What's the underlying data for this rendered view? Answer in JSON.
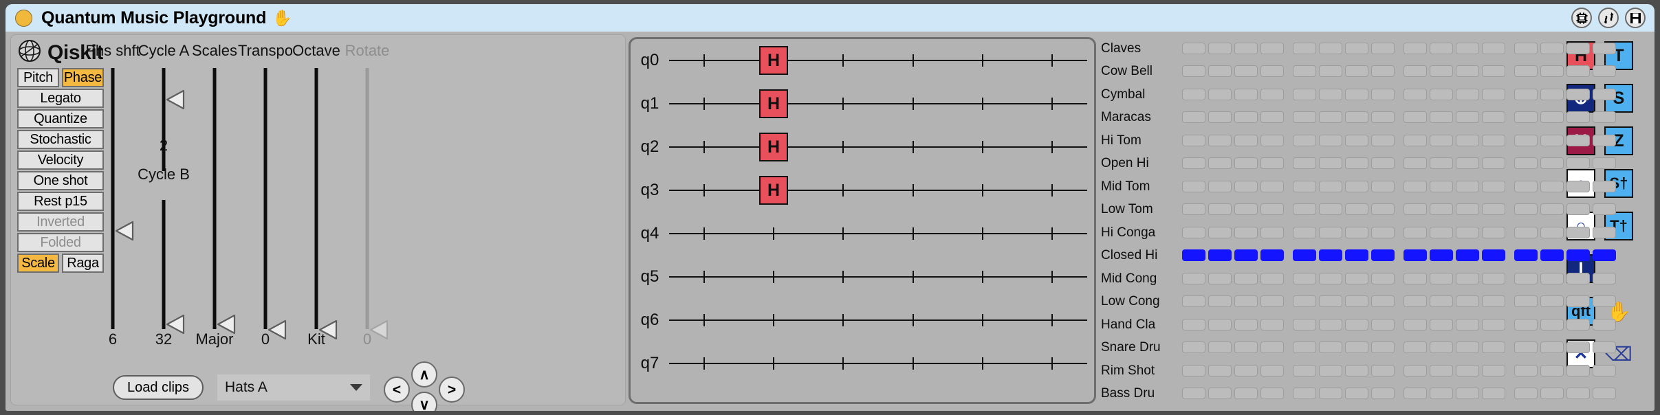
{
  "window": {
    "title": "Quantum Music Playground",
    "title_dot_color": "#f0b93c",
    "titlebar_color": "#cfe7f7",
    "hand_glyph": "✋",
    "icons": [
      {
        "name": "device-chip-icon",
        "label": "device"
      },
      {
        "name": "refresh-sync-icon",
        "label": "refresh"
      },
      {
        "name": "save-disk-icon",
        "label": "save"
      }
    ]
  },
  "left_panel": {
    "brand": "Qiskit",
    "brand_icon": "qiskit-logo-icon",
    "toggle_pair_top": [
      {
        "label": "Pitch",
        "active": false,
        "enabled": true
      },
      {
        "label": "Phase",
        "active": true,
        "enabled": true
      }
    ],
    "toggles": [
      {
        "label": "Legato",
        "active": false,
        "enabled": true
      },
      {
        "label": "Quantize",
        "active": false,
        "enabled": true
      },
      {
        "label": "Stochastic",
        "active": false,
        "enabled": true
      },
      {
        "label": "Velocity",
        "active": false,
        "enabled": true
      },
      {
        "label": "One shot",
        "active": false,
        "enabled": true
      },
      {
        "label": "Rest p15",
        "active": false,
        "enabled": true
      },
      {
        "label": "Inverted",
        "active": false,
        "enabled": false
      },
      {
        "label": "Folded",
        "active": false,
        "enabled": false
      }
    ],
    "toggle_pair_bottom": [
      {
        "label": "Scale",
        "active": true,
        "enabled": true
      },
      {
        "label": "Raga",
        "active": false,
        "enabled": true
      }
    ],
    "sliders": [
      {
        "name": "phase-shift",
        "label": "Phs shft",
        "value": "6",
        "enabled": true,
        "fill_ratio": 0.62,
        "mid_label": ""
      },
      {
        "name": "cycle-a",
        "label": "Cycle A",
        "value": "",
        "enabled": true,
        "fill_ratio": 0.22,
        "mid_label": "2"
      },
      {
        "name": "cycle-b",
        "label": "Cycle B",
        "value": "32",
        "enabled": true,
        "fill_ratio": 0.97,
        "mid_label": ""
      },
      {
        "name": "scales",
        "label": "Scales",
        "value": "Major",
        "enabled": true,
        "fill_ratio": 0.98,
        "mid_label": ""
      },
      {
        "name": "transpose",
        "label": "Transpo",
        "value": "0",
        "enabled": true,
        "fill_ratio": 1.0,
        "mid_label": ""
      },
      {
        "name": "octave",
        "label": "Octave",
        "value": "Kit",
        "enabled": true,
        "fill_ratio": 1.0,
        "mid_label": ""
      },
      {
        "name": "rotate",
        "label": "Rotate",
        "value": "0",
        "enabled": false,
        "fill_ratio": 1.0,
        "mid_label": ""
      }
    ],
    "load_clips_label": "Load clips",
    "clip_menu_value": "Hats A",
    "nav_buttons": [
      {
        "name": "nav-left-button",
        "glyph": "<"
      },
      {
        "name": "nav-up-button",
        "glyph": "∧"
      },
      {
        "name": "nav-down-button",
        "glyph": "∨"
      },
      {
        "name": "nav-right-button",
        "glyph": ">"
      }
    ]
  },
  "circuit": {
    "qubits": [
      "q0",
      "q1",
      "q2",
      "q3",
      "q4",
      "q5",
      "q6",
      "q7"
    ],
    "columns": 6,
    "gates": [
      {
        "qubit": 0,
        "column": 1,
        "label": "H",
        "type": "H"
      },
      {
        "qubit": 1,
        "column": 1,
        "label": "H",
        "type": "H"
      },
      {
        "qubit": 2,
        "column": 1,
        "label": "H",
        "type": "H"
      },
      {
        "qubit": 3,
        "column": 1,
        "label": "H",
        "type": "H"
      }
    ],
    "h_gate_color": "#e8505b"
  },
  "palette": {
    "left_column": [
      {
        "name": "gate-h",
        "label": "H",
        "style": "red"
      },
      {
        "name": "gate-cnot",
        "label": "⊕",
        "style": "navy"
      },
      {
        "name": "gate-y",
        "label": "Y",
        "style": "maroon"
      },
      {
        "name": "gate-control-filled",
        "label": "●",
        "style": "white"
      },
      {
        "name": "gate-control-open",
        "label": "○",
        "style": "white"
      },
      {
        "name": "gate-identity",
        "label": "I",
        "style": "navy"
      },
      {
        "name": "gate-qft",
        "label": "qft",
        "style": "qft"
      },
      {
        "name": "gate-x",
        "label": "✕",
        "style": "white"
      }
    ],
    "right_column": [
      {
        "name": "gate-t",
        "label": "T",
        "style": "lblue"
      },
      {
        "name": "gate-s",
        "label": "S",
        "style": "lblue"
      },
      {
        "name": "gate-z",
        "label": "Z",
        "style": "lblue"
      },
      {
        "name": "gate-s-dagger",
        "label": "S†",
        "style": "lblue"
      },
      {
        "name": "gate-t-dagger",
        "label": "T†",
        "style": "lblue"
      }
    ],
    "right_icons": [
      {
        "name": "hand-tool-icon",
        "glyph": "✋"
      },
      {
        "name": "backspace-delete-icon",
        "glyph": "⌫"
      }
    ]
  },
  "drums": {
    "steps": 16,
    "group_size": 4,
    "on_color": "#1414ff",
    "rows": [
      {
        "name": "Claves",
        "steps": [
          0,
          0,
          0,
          0,
          0,
          0,
          0,
          0,
          0,
          0,
          0,
          0,
          0,
          0,
          0,
          0
        ]
      },
      {
        "name": "Cow Bell",
        "steps": [
          0,
          0,
          0,
          0,
          0,
          0,
          0,
          0,
          0,
          0,
          0,
          0,
          0,
          0,
          0,
          0
        ]
      },
      {
        "name": "Cymbal",
        "steps": [
          0,
          0,
          0,
          0,
          0,
          0,
          0,
          0,
          0,
          0,
          0,
          0,
          0,
          0,
          0,
          0
        ]
      },
      {
        "name": "Maracas",
        "steps": [
          0,
          0,
          0,
          0,
          0,
          0,
          0,
          0,
          0,
          0,
          0,
          0,
          0,
          0,
          0,
          0
        ]
      },
      {
        "name": "Hi Tom",
        "steps": [
          0,
          0,
          0,
          0,
          0,
          0,
          0,
          0,
          0,
          0,
          0,
          0,
          0,
          0,
          0,
          0
        ]
      },
      {
        "name": "Open Hi",
        "steps": [
          0,
          0,
          0,
          0,
          0,
          0,
          0,
          0,
          0,
          0,
          0,
          0,
          0,
          0,
          0,
          0
        ]
      },
      {
        "name": "Mid Tom",
        "steps": [
          0,
          0,
          0,
          0,
          0,
          0,
          0,
          0,
          0,
          0,
          0,
          0,
          0,
          0,
          0,
          0
        ]
      },
      {
        "name": "Low Tom",
        "steps": [
          0,
          0,
          0,
          0,
          0,
          0,
          0,
          0,
          0,
          0,
          0,
          0,
          0,
          0,
          0,
          0
        ]
      },
      {
        "name": "Hi Conga",
        "steps": [
          0,
          0,
          0,
          0,
          0,
          0,
          0,
          0,
          0,
          0,
          0,
          0,
          0,
          0,
          0,
          0
        ]
      },
      {
        "name": "Closed Hi",
        "steps": [
          1,
          1,
          1,
          1,
          1,
          1,
          1,
          1,
          1,
          1,
          1,
          1,
          1,
          1,
          1,
          1
        ]
      },
      {
        "name": "Mid Cong",
        "steps": [
          0,
          0,
          0,
          0,
          0,
          0,
          0,
          0,
          0,
          0,
          0,
          0,
          0,
          0,
          0,
          0
        ]
      },
      {
        "name": "Low Cong",
        "steps": [
          0,
          0,
          0,
          0,
          0,
          0,
          0,
          0,
          0,
          0,
          0,
          0,
          0,
          0,
          0,
          0
        ]
      },
      {
        "name": "Hand Cla",
        "steps": [
          0,
          0,
          0,
          0,
          0,
          0,
          0,
          0,
          0,
          0,
          0,
          0,
          0,
          0,
          0,
          0
        ]
      },
      {
        "name": "Snare Dru",
        "steps": [
          0,
          0,
          0,
          0,
          0,
          0,
          0,
          0,
          0,
          0,
          0,
          0,
          0,
          0,
          0,
          0
        ]
      },
      {
        "name": "Rim Shot",
        "steps": [
          0,
          0,
          0,
          0,
          0,
          0,
          0,
          0,
          0,
          0,
          0,
          0,
          0,
          0,
          0,
          0
        ]
      },
      {
        "name": "Bass Dru",
        "steps": [
          0,
          0,
          0,
          0,
          0,
          0,
          0,
          0,
          0,
          0,
          0,
          0,
          0,
          0,
          0,
          0
        ]
      }
    ]
  }
}
